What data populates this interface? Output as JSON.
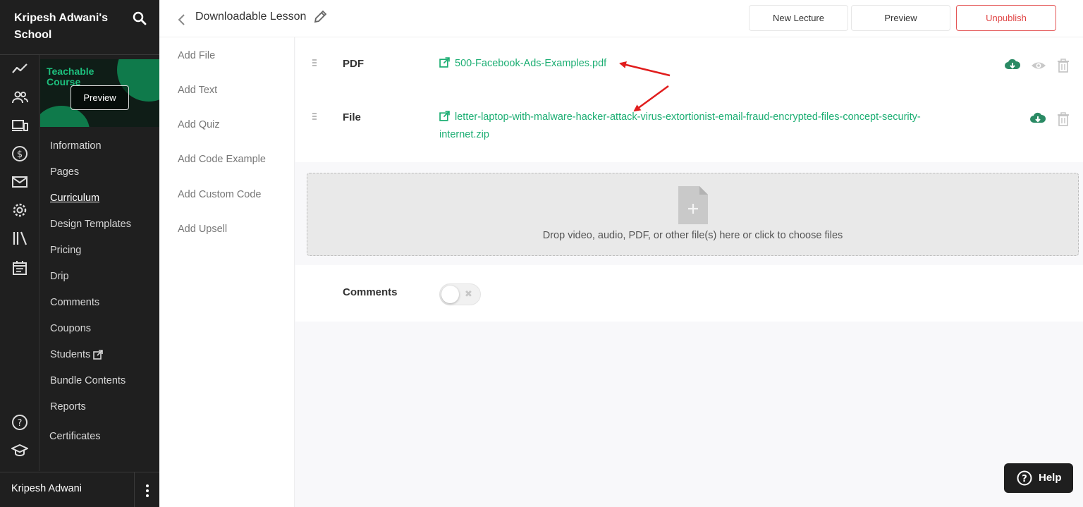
{
  "sidebar": {
    "school_name": "Kripesh Adwani's School",
    "rail_icons": [
      "trend-icon",
      "users-icon",
      "devices-icon",
      "dollar-icon",
      "mail-icon",
      "gear-icon",
      "library-icon",
      "calendar-icon",
      "help-circle-icon",
      "graduation-cap-icon"
    ],
    "course_thumbnail": {
      "title": "Teachable Course",
      "preview_label": "Preview"
    },
    "nav": [
      "Information",
      "Pages",
      "Curriculum",
      "Design Templates",
      "Pricing",
      "Drip",
      "Comments",
      "Coupons",
      "Students",
      "Bundle Contents",
      "Reports"
    ],
    "active_nav": "Curriculum",
    "nav_certificates": "Certificates",
    "user_name": "Kripesh Adwani"
  },
  "header": {
    "title": "Downloadable Lesson",
    "new_lecture": "New Lecture",
    "preview": "Preview",
    "unpublish": "Unpublish"
  },
  "add_panel": [
    "Add File",
    "Add Text",
    "Add Quiz",
    "Add Code Example",
    "Add Custom Code",
    "Add Upsell"
  ],
  "files": [
    {
      "type": "PDF",
      "name": "500-Facebook-Ads-Examples.pdf",
      "actions": [
        "download-icon",
        "eye-icon",
        "trash-icon"
      ]
    },
    {
      "type": "File",
      "name_line1": "letter-laptop-with-malware-hacker-attack-virus-extortionist-email-fraud-encrypted-files-concept-security-",
      "name_line2": "internet.zip",
      "actions": [
        "download-icon",
        "trash-icon"
      ]
    }
  ],
  "dropzone": {
    "text": "Drop video, audio, PDF, or other file(s) here or click to choose files"
  },
  "comments": {
    "label": "Comments",
    "enabled": false
  },
  "help": {
    "label": "Help"
  },
  "colors": {
    "sidebar_bg": "#1f1f1f",
    "link_green": "#1cae73",
    "unpublish_red": "#e04545",
    "annotation_red": "#e11d1d"
  }
}
